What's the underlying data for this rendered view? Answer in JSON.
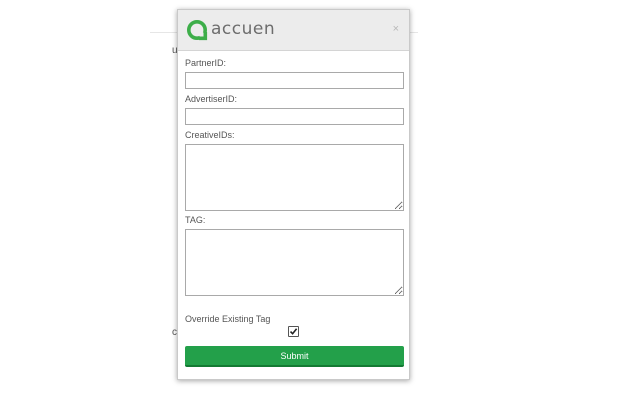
{
  "modal": {
    "logo_text": "accuen",
    "close_label": "×",
    "fields": {
      "partner_label": "PartnerID:",
      "partner_value": "",
      "advertiser_label": "AdvertiserID:",
      "advertiser_value": "",
      "creative_label": "CreativeIDs:",
      "creative_value": "",
      "tag_label": "TAG:",
      "tag_value": ""
    },
    "override_label": "Override Existing Tag",
    "override_checked": true,
    "submit_label": "Submit"
  },
  "background": {
    "fragment_1": "u",
    "fragment_2": "c"
  },
  "colors": {
    "brand_green": "#23a04a",
    "logo_green": "#3dae49",
    "header_bg": "#ececec"
  },
  "icons": {
    "logo": "accuen-logo-mark",
    "close": "close-icon",
    "check": "check-icon"
  }
}
